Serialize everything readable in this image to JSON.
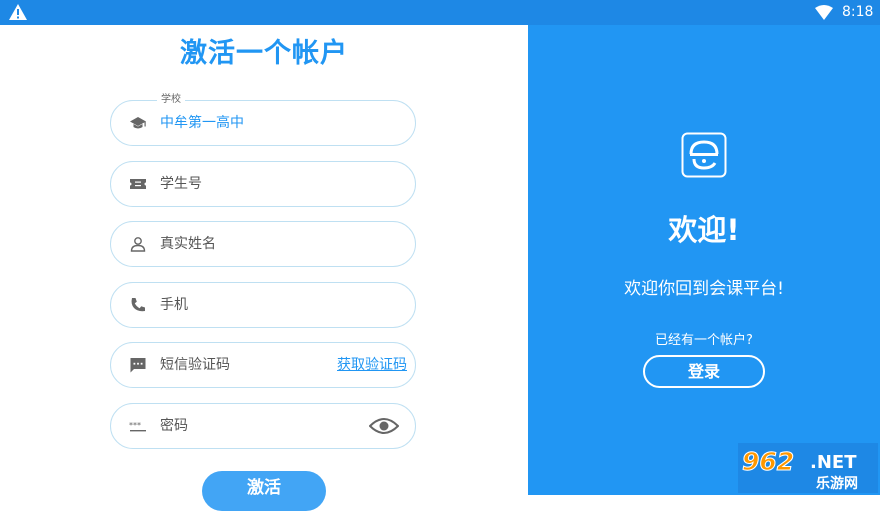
{
  "status_bar": {
    "time": "8:18",
    "warning_icon": "warning-icon",
    "wifi_icon": "wifi-icon"
  },
  "form": {
    "title": "激活一个帐户",
    "school": {
      "label": "学校",
      "value": "中牟第一高中",
      "icon": "school-cap-icon"
    },
    "student_id": {
      "placeholder": "学生号",
      "icon": "ticket-icon"
    },
    "real_name": {
      "placeholder": "真实姓名",
      "icon": "person-icon"
    },
    "phone": {
      "placeholder": "手机",
      "icon": "phone-icon"
    },
    "sms_code": {
      "placeholder": "短信验证码",
      "icon": "message-icon",
      "get_code_label": "获取验证码"
    },
    "password": {
      "placeholder": "密码",
      "icon": "password-dots-icon",
      "toggle_icon": "eye-icon"
    },
    "activate_label": "激活"
  },
  "welcome_panel": {
    "logo_icon": "app-logo-icon",
    "title": "欢迎!",
    "subtitle": "欢迎你回到会课平台!",
    "have_account": "已经有一个帐户?",
    "login_label": "登录"
  },
  "watermark": {
    "number": "962",
    "suffix": ".NET",
    "name": "乐游网"
  },
  "colors": {
    "accent": "#2196f3",
    "status_bar": "#1e88e5",
    "field_border": "#bfe0f2"
  }
}
